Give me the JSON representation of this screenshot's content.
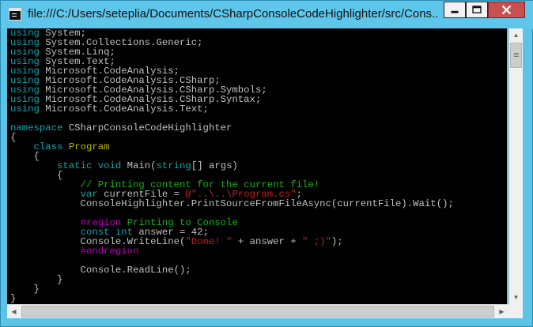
{
  "window": {
    "title": "file:///C:/Users/seteplia/Documents/CSharpConsoleCodeHighlighter/src/Cons...",
    "icon": "console-window-icon",
    "buttons": {
      "minimize": "minimize-icon",
      "maximize": "maximize-icon",
      "close": "close-icon"
    }
  },
  "colors": {
    "console_background": "#000000",
    "keyword": "#0aa6b0",
    "type": "#b5b600",
    "comment": "#18b018",
    "string": "#c02020",
    "preprocessor": "#b000b0",
    "plain": "#c0c0c0",
    "close_button": "#c75050",
    "titlebar": "#5ec6ea"
  },
  "code_lines": [
    [
      [
        "kw",
        "using"
      ],
      [
        "p",
        " System;"
      ]
    ],
    [
      [
        "kw",
        "using"
      ],
      [
        "p",
        " System.Collections.Generic;"
      ]
    ],
    [
      [
        "kw",
        "using"
      ],
      [
        "p",
        " System.Linq;"
      ]
    ],
    [
      [
        "kw",
        "using"
      ],
      [
        "p",
        " System.Text;"
      ]
    ],
    [
      [
        "kw",
        "using"
      ],
      [
        "p",
        " Microsoft.CodeAnalysis;"
      ]
    ],
    [
      [
        "kw",
        "using"
      ],
      [
        "p",
        " Microsoft.CodeAnalysis.CSharp;"
      ]
    ],
    [
      [
        "kw",
        "using"
      ],
      [
        "p",
        " Microsoft.CodeAnalysis.CSharp.Symbols;"
      ]
    ],
    [
      [
        "kw",
        "using"
      ],
      [
        "p",
        " Microsoft.CodeAnalysis.CSharp.Syntax;"
      ]
    ],
    [
      [
        "kw",
        "using"
      ],
      [
        "p",
        " Microsoft.CodeAnalysis.Text;"
      ]
    ],
    [],
    [
      [
        "kw",
        "namespace"
      ],
      [
        "p",
        " CSharpConsoleCodeHighlighter"
      ]
    ],
    [
      [
        "p",
        "{"
      ]
    ],
    [
      [
        "p",
        "    "
      ],
      [
        "kw",
        "class"
      ],
      [
        "p",
        " "
      ],
      [
        "type",
        "Program"
      ]
    ],
    [
      [
        "p",
        "    {"
      ]
    ],
    [
      [
        "p",
        "        "
      ],
      [
        "kw",
        "static"
      ],
      [
        "p",
        " "
      ],
      [
        "kw",
        "void"
      ],
      [
        "p",
        " Main("
      ],
      [
        "kw",
        "string"
      ],
      [
        "p",
        "[] args)"
      ]
    ],
    [
      [
        "p",
        "        {"
      ]
    ],
    [
      [
        "p",
        "            "
      ],
      [
        "cm",
        "// Printing content for the current file!"
      ]
    ],
    [
      [
        "p",
        "            "
      ],
      [
        "kw",
        "var"
      ],
      [
        "p",
        " currentFile = "
      ],
      [
        "str",
        "@\"..\\..\\Program.cs\""
      ],
      [
        "p",
        ";"
      ]
    ],
    [
      [
        "p",
        "            ConsoleHighlighter.PrintSourceFromFileAsync(currentFile).Wait();"
      ]
    ],
    [],
    [
      [
        "p",
        "            "
      ],
      [
        "reg",
        "#region"
      ],
      [
        "p",
        " "
      ],
      [
        "regtxt",
        "Printing to Console"
      ]
    ],
    [
      [
        "p",
        "            "
      ],
      [
        "kw",
        "const"
      ],
      [
        "p",
        " "
      ],
      [
        "kw",
        "int"
      ],
      [
        "p",
        " answer = 42;"
      ]
    ],
    [
      [
        "p",
        "            Console.WriteLine("
      ],
      [
        "str",
        "\"Done! \""
      ],
      [
        "p",
        " + answer + "
      ],
      [
        "str",
        "\" ;)\""
      ],
      [
        "p",
        ");"
      ]
    ],
    [
      [
        "p",
        "            "
      ],
      [
        "reg",
        "#endregion"
      ]
    ],
    [],
    [
      [
        "p",
        "            Console.ReadLine();"
      ]
    ],
    [
      [
        "p",
        "        }"
      ]
    ],
    [
      [
        "p",
        "    }"
      ]
    ],
    [
      [
        "p",
        "}"
      ]
    ]
  ]
}
